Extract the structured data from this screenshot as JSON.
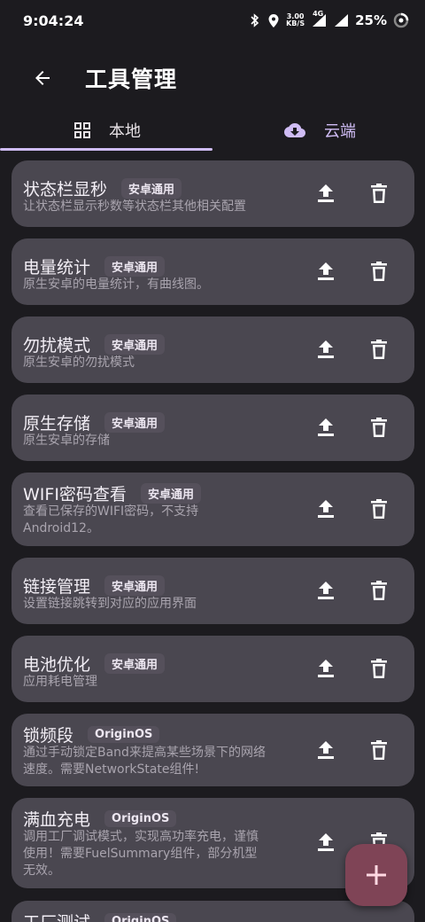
{
  "status": {
    "time": "9:04:24",
    "net_speed_value": "3.00",
    "net_speed_unit": "KB/S",
    "network_type": "4G",
    "battery": "25%"
  },
  "header": {
    "title": "工具管理"
  },
  "tabs": [
    {
      "label": "本地",
      "icon": "grid-icon",
      "active": true
    },
    {
      "label": "云端",
      "icon": "cloud-download-icon",
      "active": false
    }
  ],
  "tools": [
    {
      "name": "状态栏显秒",
      "tag": "安卓通用",
      "description": [
        "让状态栏显示秒数等状态栏其他相关配置"
      ]
    },
    {
      "name": "电量统计",
      "tag": "安卓通用",
      "description": [
        "原生安卓的电量统计，有曲线图。"
      ]
    },
    {
      "name": "勿扰模式",
      "tag": "安卓通用",
      "description": [
        "原生安卓的勿扰模式"
      ]
    },
    {
      "name": "原生存储",
      "tag": "安卓通用",
      "description": [
        "原生安卓的存储"
      ]
    },
    {
      "name": "WIFI密码查看",
      "tag": "安卓通用",
      "description": [
        "查看已保存的WIFI密码，不支持",
        "Android12。"
      ]
    },
    {
      "name": "链接管理",
      "tag": "安卓通用",
      "description": [
        "设置链接跳转到对应的应用界面"
      ]
    },
    {
      "name": "电池优化",
      "tag": "安卓通用",
      "description": [
        "应用耗电管理"
      ]
    },
    {
      "name": "锁频段",
      "tag": "OriginOS",
      "description": [
        "通过手动锁定Band来提高某些场景下的网络",
        "速度。需要NetworkState组件!"
      ]
    },
    {
      "name": "满血充电",
      "tag": "OriginOS",
      "description": [
        "调用工厂调试模式，实现高功率充电，谨慎",
        "使用！需要FuelSummary组件，部分机型",
        "无效。"
      ]
    },
    {
      "name": "工厂测试",
      "tag": "OriginOS",
      "description": []
    }
  ],
  "icons": {
    "upload": "upload-icon",
    "delete": "trash-icon",
    "fab": "plus-icon",
    "back": "arrow-left-icon"
  },
  "colors": {
    "background": "#1c1b1f",
    "card": "#4a4750",
    "accent": "#cfbcf4",
    "fab": "#7f4456"
  }
}
